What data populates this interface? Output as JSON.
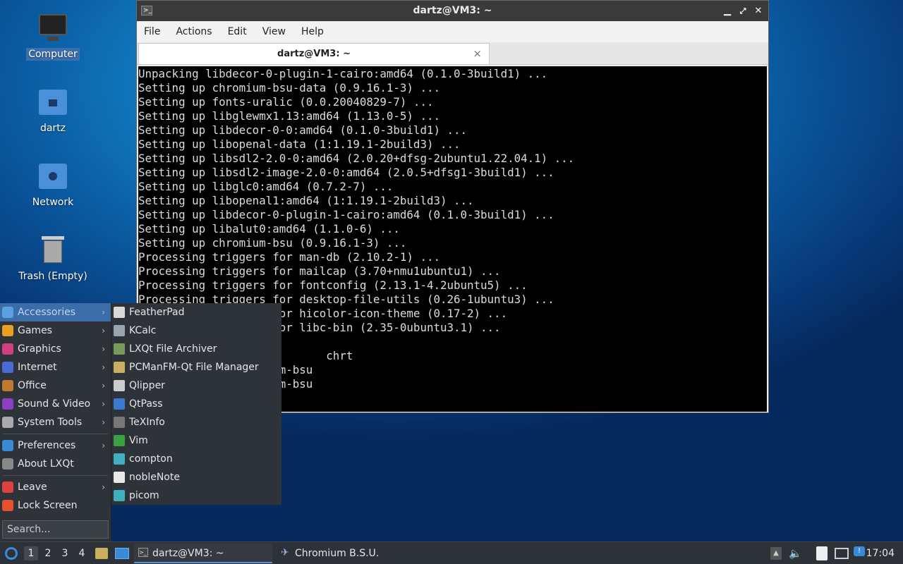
{
  "desktop": {
    "icons": [
      {
        "label": "Computer"
      },
      {
        "label": "dartz"
      },
      {
        "label": "Network"
      },
      {
        "label": "Trash (Empty)"
      }
    ]
  },
  "window": {
    "title": "dartz@VM3: ~",
    "menu": [
      "File",
      "Actions",
      "Edit",
      "View",
      "Help"
    ],
    "tab_title": "dartz@VM3: ~",
    "tab_close": "×",
    "terminal_lines": [
      "Unpacking libdecor-0-plugin-1-cairo:amd64 (0.1.0-3build1) ...",
      "Setting up chromium-bsu-data (0.9.16.1-3) ...",
      "Setting up fonts-uralic (0.0.20040829-7) ...",
      "Setting up libglewmx1.13:amd64 (1.13.0-5) ...",
      "Setting up libdecor-0-0:amd64 (0.1.0-3build1) ...",
      "Setting up libopenal-data (1:1.19.1-2build3) ...",
      "Setting up libsdl2-2.0-0:amd64 (2.0.20+dfsg-2ubuntu1.22.04.1) ...",
      "Setting up libsdl2-image-2.0-0:amd64 (2.0.5+dfsg1-3build1) ...",
      "Setting up libglc0:amd64 (0.7.2-7) ...",
      "Setting up libopenal1:amd64 (1:1.19.1-2build3) ...",
      "Setting up libdecor-0-plugin-1-cairo:amd64 (0.1.0-3build1) ...",
      "Setting up libalut0:amd64 (1.1.0-6) ...",
      "Setting up chromium-bsu (0.9.16.1-3) ...",
      "Processing triggers for man-db (2.10.2-1) ...",
      "Processing triggers for mailcap (3.70+nmu1ubuntu1) ...",
      "Processing triggers for fontconfig (2.13.1-4.2ubuntu5) ...",
      "Processing triggers for desktop-file-utils (0.26-1ubuntu3) ...",
      "Processing triggers for hicolor-icon-theme (0.17-2) ...",
      "Processing triggers for libc-bin (2.35-0ubuntu3.1) ...",
      "",
      "                            chrt",
      "                     m-bsu",
      "                     m-bsu"
    ]
  },
  "start_menu": {
    "items": [
      {
        "label": "Accessories",
        "icon": "accessories-icon",
        "color": "#5aa0e0",
        "submenu": true
      },
      {
        "label": "Games",
        "icon": "games-icon",
        "color": "#e8a020",
        "submenu": true
      },
      {
        "label": "Graphics",
        "icon": "graphics-icon",
        "color": "#d04080",
        "submenu": true
      },
      {
        "label": "Internet",
        "icon": "internet-icon",
        "color": "#4a6ad8",
        "submenu": true
      },
      {
        "label": "Office",
        "icon": "office-icon",
        "color": "#c07a30",
        "submenu": true
      },
      {
        "label": "Sound & Video",
        "icon": "sound-video-icon",
        "color": "#8a40c0",
        "submenu": true
      },
      {
        "label": "System Tools",
        "icon": "system-tools-icon",
        "color": "#aaaaaa",
        "submenu": true
      }
    ],
    "items2": [
      {
        "label": "Preferences",
        "icon": "preferences-icon",
        "color": "#3a8ad8",
        "submenu": true
      },
      {
        "label": "About LXQt",
        "icon": "about-icon",
        "color": "#888888",
        "submenu": false
      }
    ],
    "items3": [
      {
        "label": "Leave",
        "icon": "leave-icon",
        "color": "#e04040",
        "submenu": true
      },
      {
        "label": "Lock Screen",
        "icon": "lock-icon",
        "color": "#e85030",
        "submenu": false
      }
    ],
    "search_placeholder": "Search...",
    "arrow": "›"
  },
  "accessories_submenu": [
    {
      "label": "FeatherPad",
      "icon": "featherpad-icon",
      "color": "#d8d8d8"
    },
    {
      "label": "KCalc",
      "icon": "kcalc-icon",
      "color": "#9aa4ae"
    },
    {
      "label": "LXQt File Archiver",
      "icon": "archiver-icon",
      "color": "#7a9a5a"
    },
    {
      "label": "PCManFM-Qt File Manager",
      "icon": "file-manager-icon",
      "color": "#c8b060"
    },
    {
      "label": "Qlipper",
      "icon": "qlipper-icon",
      "color": "#cccccc"
    },
    {
      "label": "QtPass",
      "icon": "qtpass-icon",
      "color": "#3a7ad0"
    },
    {
      "label": "TeXInfo",
      "icon": "texinfo-icon",
      "color": "#777777"
    },
    {
      "label": "Vim",
      "icon": "vim-icon",
      "color": "#3aa040"
    },
    {
      "label": "compton",
      "icon": "compton-icon",
      "color": "#40b0c0"
    },
    {
      "label": "nobleNote",
      "icon": "noblenote-icon",
      "color": "#e8e8e8"
    },
    {
      "label": "picom",
      "icon": "picom-icon",
      "color": "#40b0c0"
    }
  ],
  "taskbar": {
    "desktops": [
      "1",
      "2",
      "3",
      "4"
    ],
    "tasks": [
      {
        "label": "dartz@VM3: ~"
      },
      {
        "label": "Chromium B.S.U."
      }
    ],
    "clock": "17:04"
  }
}
